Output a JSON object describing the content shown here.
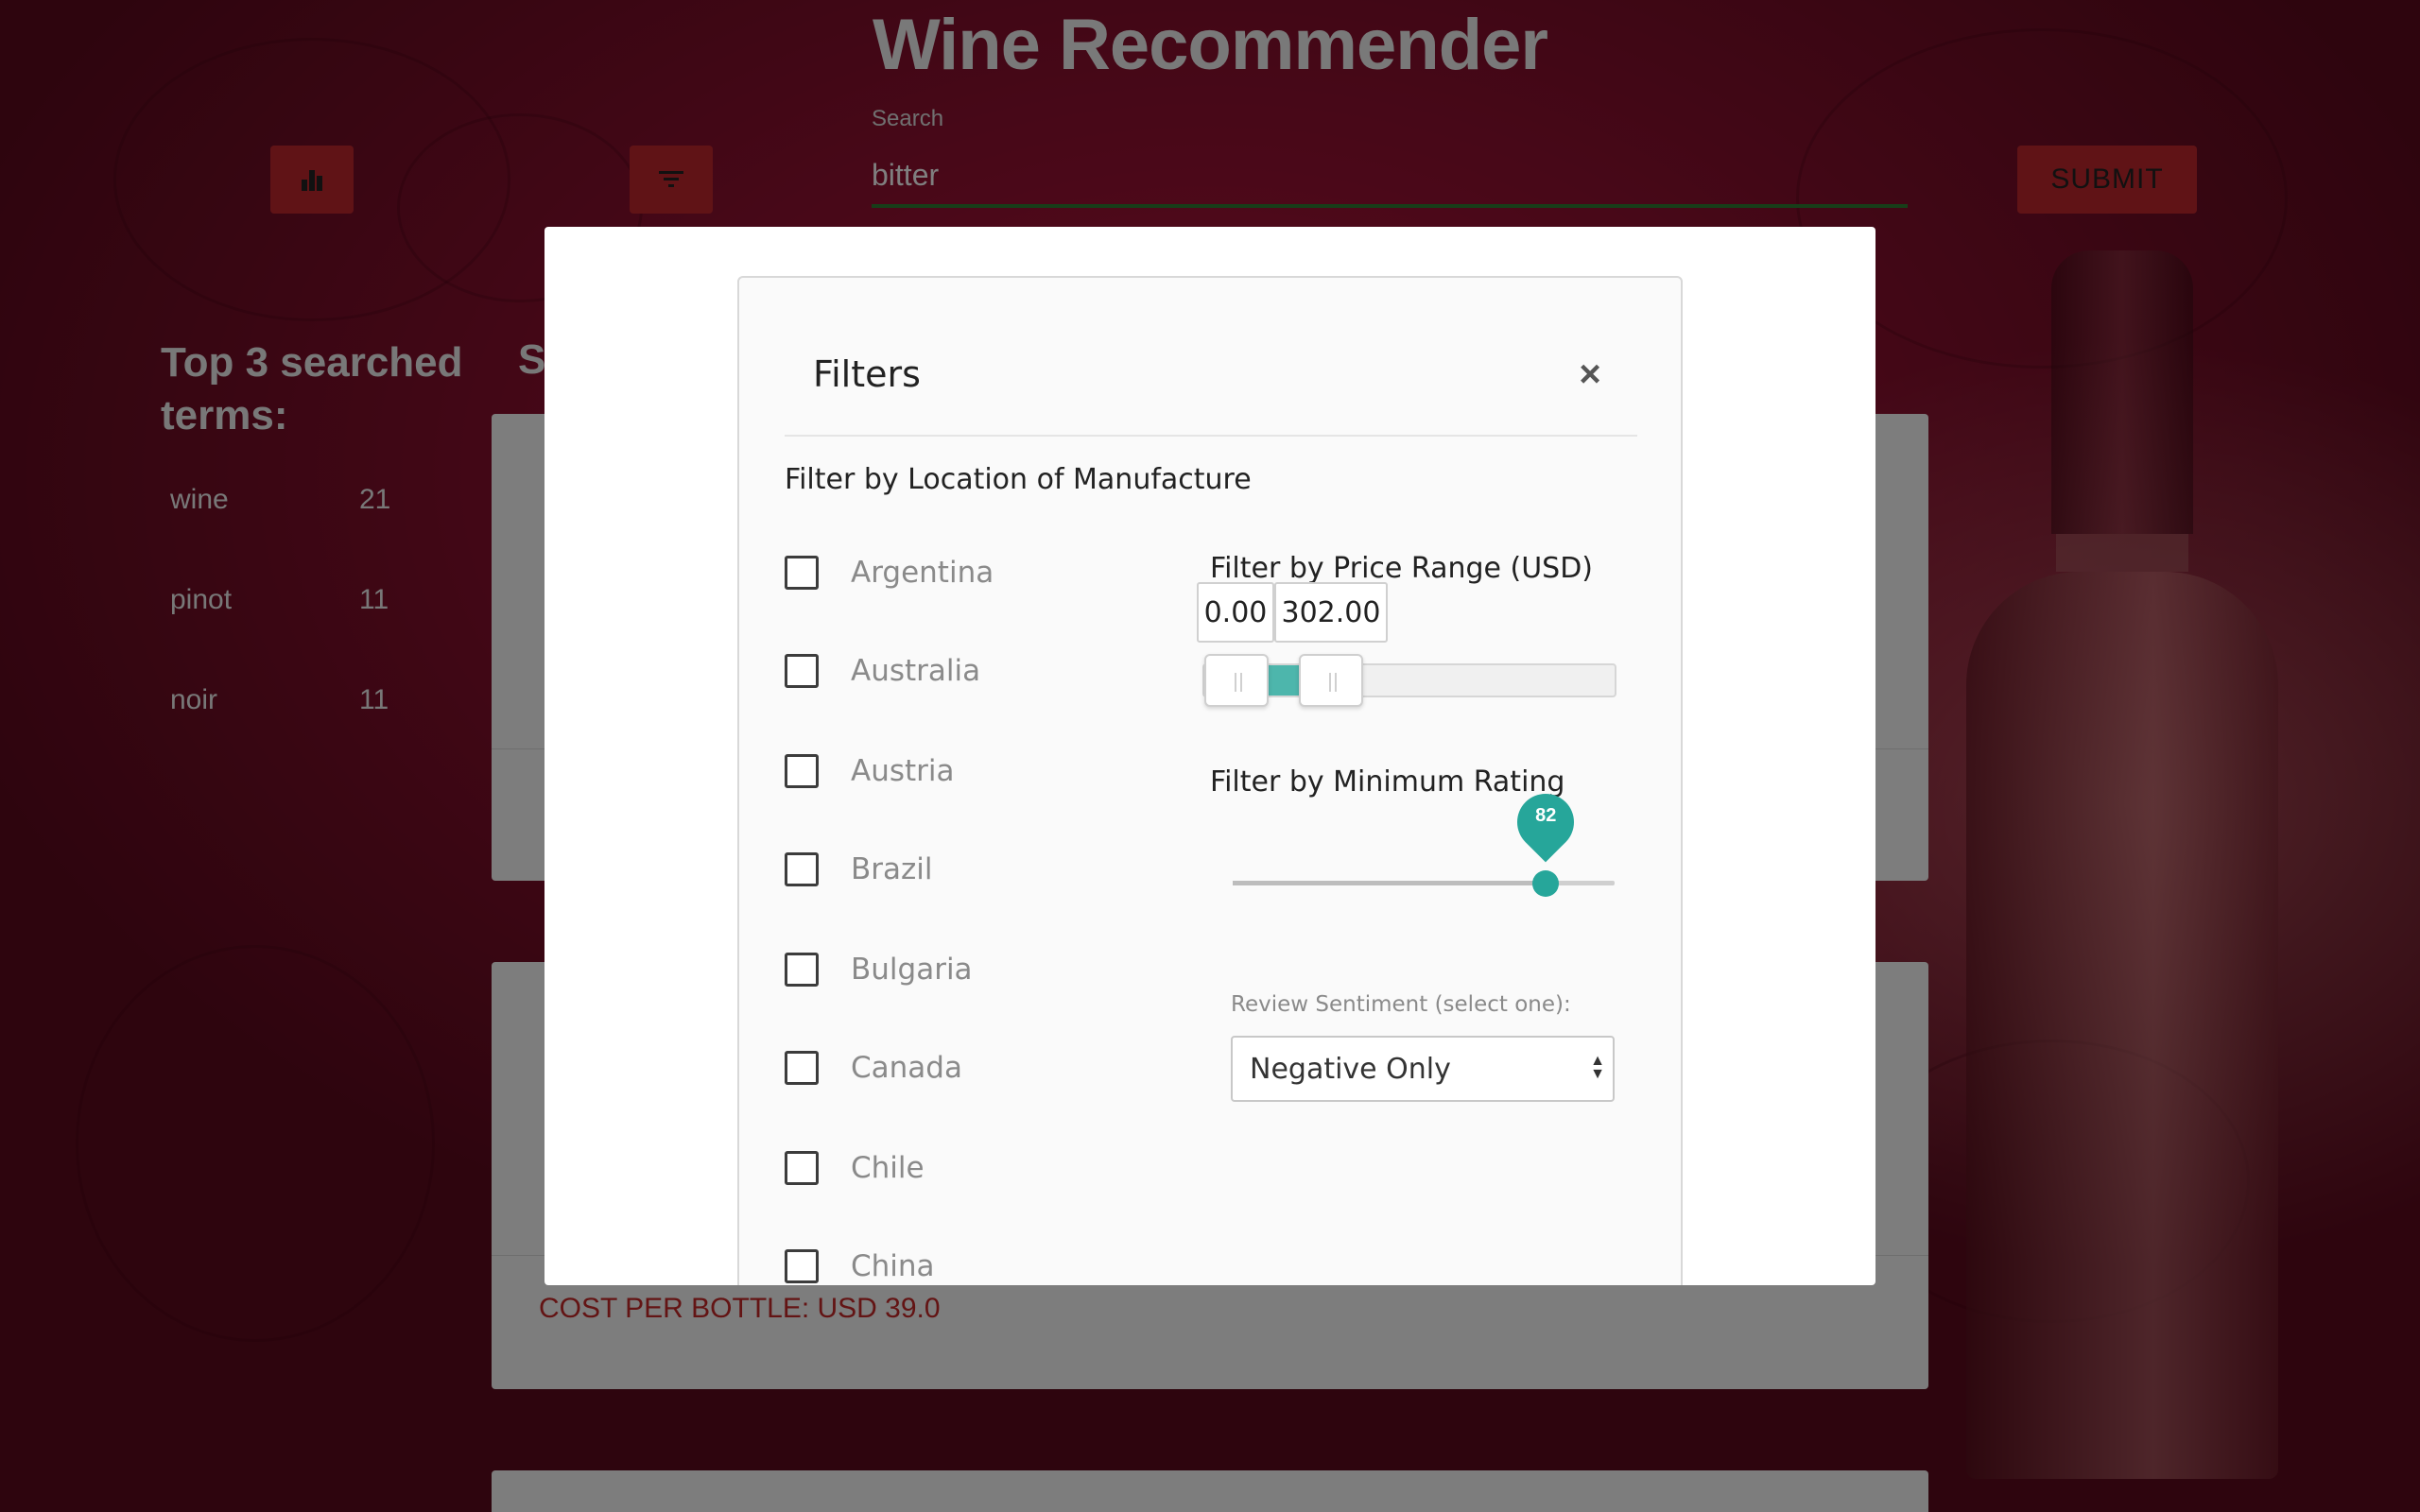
{
  "app": {
    "title": "Wine Recommender"
  },
  "toolbar": {
    "stats_icon": "bar-chart-icon",
    "filter_icon": "filter-icon",
    "submit_label": "SUBMIT"
  },
  "search": {
    "label": "Search",
    "value": "bitter"
  },
  "top_terms": {
    "title": "Top 3 searched terms:",
    "items": [
      {
        "term": "wine",
        "count": "21"
      },
      {
        "term": "pinot",
        "count": "11"
      },
      {
        "term": "noir",
        "count": "11"
      }
    ]
  },
  "results": {
    "heading_partial": "S",
    "card2_cost": "COST PER BOTTLE: USD 39.0"
  },
  "filters": {
    "title": "Filters",
    "close_icon": "close-icon",
    "location": {
      "heading": "Filter by Location of Manufacture",
      "countries": [
        "Argentina",
        "Australia",
        "Austria",
        "Brazil",
        "Bulgaria",
        "Canada",
        "Chile",
        "China"
      ]
    },
    "price": {
      "heading": "Filter by Price Range (USD)",
      "min": "0.00",
      "max": "302.00"
    },
    "rating": {
      "heading": "Filter by Minimum Rating",
      "value": "82"
    },
    "sentiment": {
      "label": "Review Sentiment (select one):",
      "selected": "Negative Only"
    }
  },
  "colors": {
    "accent_teal": "#26a69a",
    "button_red": "#c1272d",
    "cost_red": "#c62828"
  }
}
